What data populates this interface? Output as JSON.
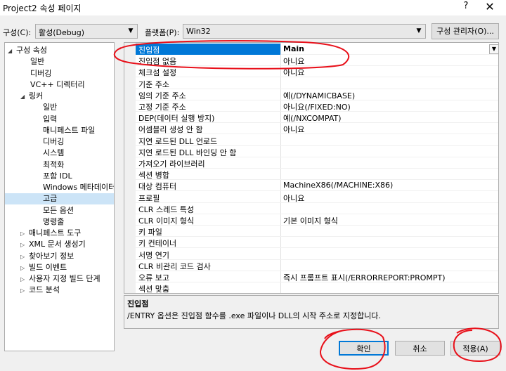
{
  "window": {
    "title": "Project2 속성 페이지",
    "help": "?",
    "close": "✕"
  },
  "toolbar": {
    "config_label": "구성(C):",
    "config_value": "활성(Debug)",
    "platform_label": "플랫폼(P):",
    "platform_value": "Win32",
    "config_manager": "구성 관리자(O)..."
  },
  "tree": {
    "items": [
      {
        "label": "구성 속성",
        "level": 0,
        "twisty": "◢"
      },
      {
        "label": "일반",
        "level": 1
      },
      {
        "label": "디버깅",
        "level": 1
      },
      {
        "label": "VC++ 디렉터리",
        "level": 1
      },
      {
        "label": "링커",
        "level": 1,
        "twisty": "◢"
      },
      {
        "label": "일반",
        "level": 2
      },
      {
        "label": "입력",
        "level": 2
      },
      {
        "label": "매니페스트 파일",
        "level": 2
      },
      {
        "label": "디버깅",
        "level": 2
      },
      {
        "label": "시스템",
        "level": 2
      },
      {
        "label": "최적화",
        "level": 2
      },
      {
        "label": "포함 IDL",
        "level": 2
      },
      {
        "label": "Windows 메타데이터",
        "level": 2
      },
      {
        "label": "고급",
        "level": 2,
        "selected": true
      },
      {
        "label": "모든 옵션",
        "level": 2
      },
      {
        "label": "명령줄",
        "level": 2
      },
      {
        "label": "매니페스트 도구",
        "level": 1,
        "twisty": "▷"
      },
      {
        "label": "XML 문서 생성기",
        "level": 1,
        "twisty": "▷"
      },
      {
        "label": "찾아보기 정보",
        "level": 1,
        "twisty": "▷"
      },
      {
        "label": "빌드 이벤트",
        "level": 1,
        "twisty": "▷"
      },
      {
        "label": "사용자 지정 빌드 단계",
        "level": 1,
        "twisty": "▷"
      },
      {
        "label": "코드 분석",
        "level": 1,
        "twisty": "▷"
      }
    ]
  },
  "properties": {
    "rows": [
      {
        "name": "진입점",
        "value": "Main",
        "selected": true
      },
      {
        "name": "진입점 없음",
        "value": "아니요"
      },
      {
        "name": "체크섬 설정",
        "value": "아니요"
      },
      {
        "name": "기준 주소",
        "value": ""
      },
      {
        "name": "임의 기준 주소",
        "value": "예(/DYNAMICBASE)"
      },
      {
        "name": "고정 기준 주소",
        "value": "아니요(/FIXED:NO)"
      },
      {
        "name": "DEP(데이터 실행 방지)",
        "value": "예(/NXCOMPAT)"
      },
      {
        "name": "어셈블리 생성 안 함",
        "value": "아니요"
      },
      {
        "name": "지연 로드된 DLL 언로드",
        "value": ""
      },
      {
        "name": "지연 로드된 DLL 바인딩 안 함",
        "value": ""
      },
      {
        "name": "가져오기 라이브러리",
        "value": ""
      },
      {
        "name": "섹션 병합",
        "value": ""
      },
      {
        "name": "대상 컴퓨터",
        "value": "MachineX86(/MACHINE:X86)"
      },
      {
        "name": "프로필",
        "value": "아니요"
      },
      {
        "name": "CLR 스레드 특성",
        "value": ""
      },
      {
        "name": "CLR 이미지 형식",
        "value": "기본 이미지 형식"
      },
      {
        "name": "키 파일",
        "value": ""
      },
      {
        "name": "키 컨테이너",
        "value": ""
      },
      {
        "name": "서명 연기",
        "value": ""
      },
      {
        "name": "CLR 비관리 코드 검사",
        "value": ""
      },
      {
        "name": "오류 보고",
        "value": "즉시 프롬프트 표시(/ERRORREPORT:PROMPT)"
      },
      {
        "name": "섹션 맞춤",
        "value": ""
      }
    ]
  },
  "description": {
    "title": "진입점",
    "text": "/ENTRY 옵션은 진입점 함수를 .exe 파일이나 DLL의 시작 주소로 지정합니다."
  },
  "buttons": {
    "ok": "확인",
    "cancel": "취소",
    "apply": "적용(A)"
  },
  "colors": {
    "selection": "#0078d7",
    "tree_selection": "#cce4f7",
    "annotation": "#e8101a"
  }
}
